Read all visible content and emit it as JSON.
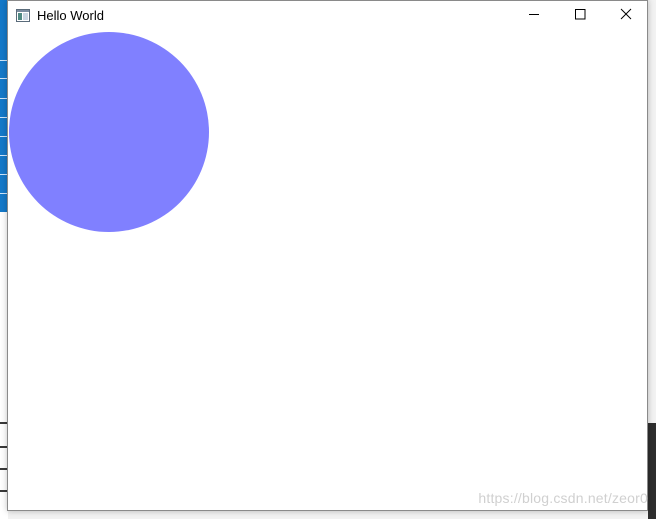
{
  "window": {
    "title": "Hello World",
    "minimize_label": "Minimize",
    "maximize_label": "Maximize",
    "close_label": "Close"
  },
  "canvas": {
    "circle_color": "#8080ff",
    "background_color": "#ffffff"
  },
  "watermark": {
    "text": "https://blog.csdn.net/zeor0"
  },
  "icons": {
    "app": "app-window-icon",
    "minimize": "minimize-icon",
    "maximize": "maximize-icon",
    "close": "close-icon"
  }
}
